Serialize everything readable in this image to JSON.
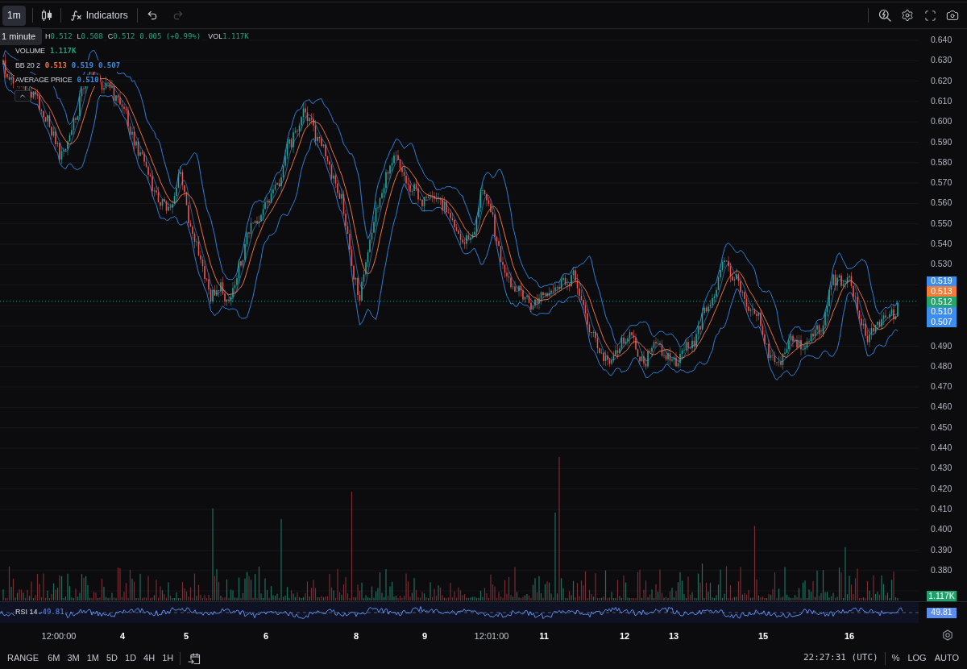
{
  "toolbar": {
    "interval": {
      "label": "1m",
      "selected": true
    },
    "indicators": {
      "label": "Indicators"
    },
    "undo": {
      "disabled": false
    },
    "redo": {
      "disabled": true
    }
  },
  "tooltip": {
    "text": "1 minute"
  },
  "legend": {
    "fields": [
      {
        "label": "H",
        "value": "0.512"
      },
      {
        "label": "L",
        "value": "0.508"
      },
      {
        "label": "C",
        "value": "0.512"
      }
    ],
    "change": "0.005 (+0.99%)",
    "volume": {
      "label": "VOL",
      "value": "1.117K"
    }
  },
  "indicators": [
    {
      "name": "VOLUME",
      "values": [
        {
          "text": "1.117K",
          "color": "#26a17b"
        }
      ]
    },
    {
      "name": "BB 20 2",
      "values": [
        {
          "text": "0.513",
          "color": "#f2773a"
        },
        {
          "text": "0.519",
          "color": "#3f8de0"
        },
        {
          "text": "0.507",
          "color": "#3f8de0"
        }
      ]
    },
    {
      "name": "AVERAGE PRICE",
      "values": [
        {
          "text": "0.510",
          "color": "#3f8de0"
        }
      ]
    }
  ],
  "price_axis": {
    "ticks_above": [
      "0.640",
      "0.630",
      "0.620",
      "0.610",
      "0.600",
      "0.590",
      "0.580",
      "0.570",
      "0.560",
      "0.550",
      "0.540",
      "0.530"
    ],
    "badges": [
      {
        "text": "0.519",
        "color": "#3b8ef0"
      },
      {
        "text": "0.513",
        "color": "#f47b36"
      },
      {
        "text": "0.512",
        "color": "#23a46c"
      },
      {
        "text": "0.510",
        "color": "#3b8ef0"
      },
      {
        "text": "0.507",
        "color": "#3b8ef0"
      }
    ],
    "ticks_below": [
      "0.490",
      "0.480",
      "0.470",
      "0.460",
      "0.450",
      "0.440",
      "0.430",
      "0.420",
      "0.410",
      "0.400",
      "0.390",
      "0.380"
    ],
    "volume_badge": {
      "text": "1.117K",
      "color": "#22a06b"
    }
  },
  "rsi": {
    "label": "RSI 14",
    "value": "49.81",
    "badge": {
      "text": "49.81",
      "color": "#5b8def"
    }
  },
  "time_axis": [
    {
      "label": "12:00:00",
      "kind": "time"
    },
    {
      "label": "4",
      "kind": "day"
    },
    {
      "label": "5",
      "kind": "day"
    },
    {
      "label": "6",
      "kind": "day"
    },
    {
      "label": "8",
      "kind": "day"
    },
    {
      "label": "9",
      "kind": "day"
    },
    {
      "label": "12:01:00",
      "kind": "time"
    },
    {
      "label": "11",
      "kind": "day"
    },
    {
      "label": "12",
      "kind": "day"
    },
    {
      "label": "13",
      "kind": "day"
    },
    {
      "label": "15",
      "kind": "day"
    },
    {
      "label": "16",
      "kind": "day"
    }
  ],
  "bottom_bar": {
    "range_label": "RANGE",
    "ranges": [
      "6M",
      "3M",
      "1M",
      "5D",
      "1D",
      "4H",
      "1H"
    ],
    "clock": "22:27:31 (UTC)",
    "scale_options": [
      "%",
      "LOG",
      "AUTO"
    ]
  }
}
